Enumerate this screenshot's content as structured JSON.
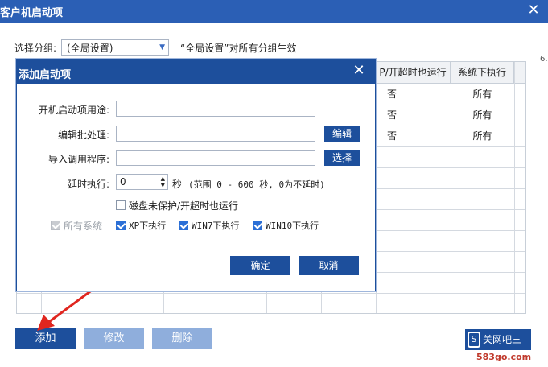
{
  "window": {
    "title": "客户机启动项",
    "close": "✕"
  },
  "group": {
    "label": "选择分组:",
    "selected": "(全局设置)",
    "note": "“全局设置”对所有分组生效"
  },
  "table": {
    "headers": [
      "P/开超时也运行",
      "系统下执行"
    ],
    "rows": [
      [
        "否",
        "所有"
      ],
      [
        "否",
        "所有"
      ],
      [
        "否",
        "所有"
      ]
    ],
    "edge_text": "6."
  },
  "buttons": {
    "add": "添加",
    "edit": "修改",
    "delete": "删除"
  },
  "watermark": {
    "logo": "S",
    "text": "关网吧三",
    "domain": "583go.com"
  },
  "dialog": {
    "title": "添加启动项",
    "close": "✕",
    "purpose_label": "开机启动项用途:",
    "purpose_value": "",
    "batch_label": "编辑批处理:",
    "batch_value": "",
    "batch_button": "编辑",
    "import_label": "导入调用程序:",
    "import_value": "",
    "import_button": "选择",
    "delay_label": "延时执行:",
    "delay_value": "0",
    "delay_unit": "秒",
    "delay_note": "(范围 0 - 600 秒, 0为不延时)",
    "disk_checkbox": "磁盘未保护/开超时也运行",
    "all_systems": "所有系统",
    "xp": "XP下执行",
    "win7": "WIN7下执行",
    "win10": "WIN10下执行",
    "ok": "确定",
    "cancel": "取消"
  }
}
